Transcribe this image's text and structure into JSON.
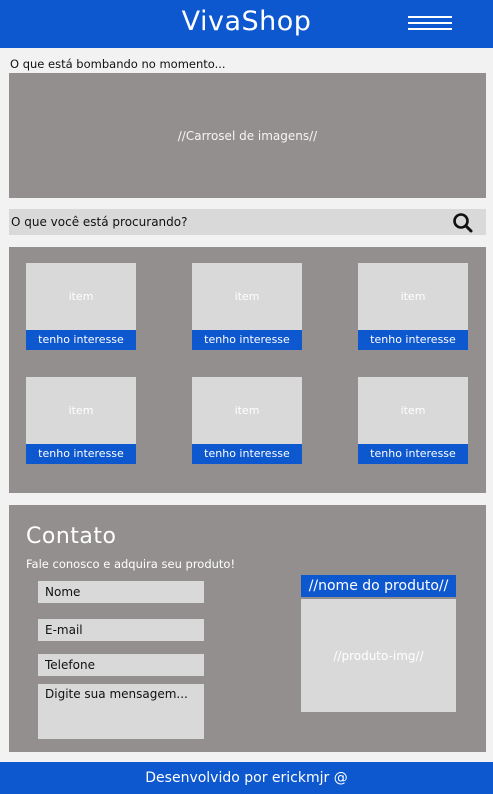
{
  "header": {
    "brand": "VivaShop",
    "menu_icon": "hamburger-menu-icon"
  },
  "trending": {
    "title": "O que está bombando no momento...",
    "carousel_label": "//Carrosel de imagens//"
  },
  "search": {
    "placeholder": "O que você está procurando?",
    "icon": "search-icon"
  },
  "products": {
    "items": [
      {
        "label": "item",
        "button": "tenho interesse"
      },
      {
        "label": "item",
        "button": "tenho interesse"
      },
      {
        "label": "item",
        "button": "tenho interesse"
      },
      {
        "label": "item",
        "button": "tenho interesse"
      },
      {
        "label": "item",
        "button": "tenho interesse"
      },
      {
        "label": "item",
        "button": "tenho interesse"
      }
    ]
  },
  "contact": {
    "title": "Contato",
    "subtitle": "Fale conosco e adquira seu produto!",
    "name_placeholder": "Nome",
    "email_placeholder": "E-mail",
    "phone_placeholder": "Telefone",
    "message_placeholder": "Digite sua mensagem...",
    "product_name": "//nome do produto//",
    "product_img": "//produto-img//"
  },
  "footer": {
    "text": "Desenvolvido por erickmjr @"
  },
  "colors": {
    "accent": "#0d57cf",
    "panel": "#938f8e",
    "field": "#d9d9d9"
  }
}
